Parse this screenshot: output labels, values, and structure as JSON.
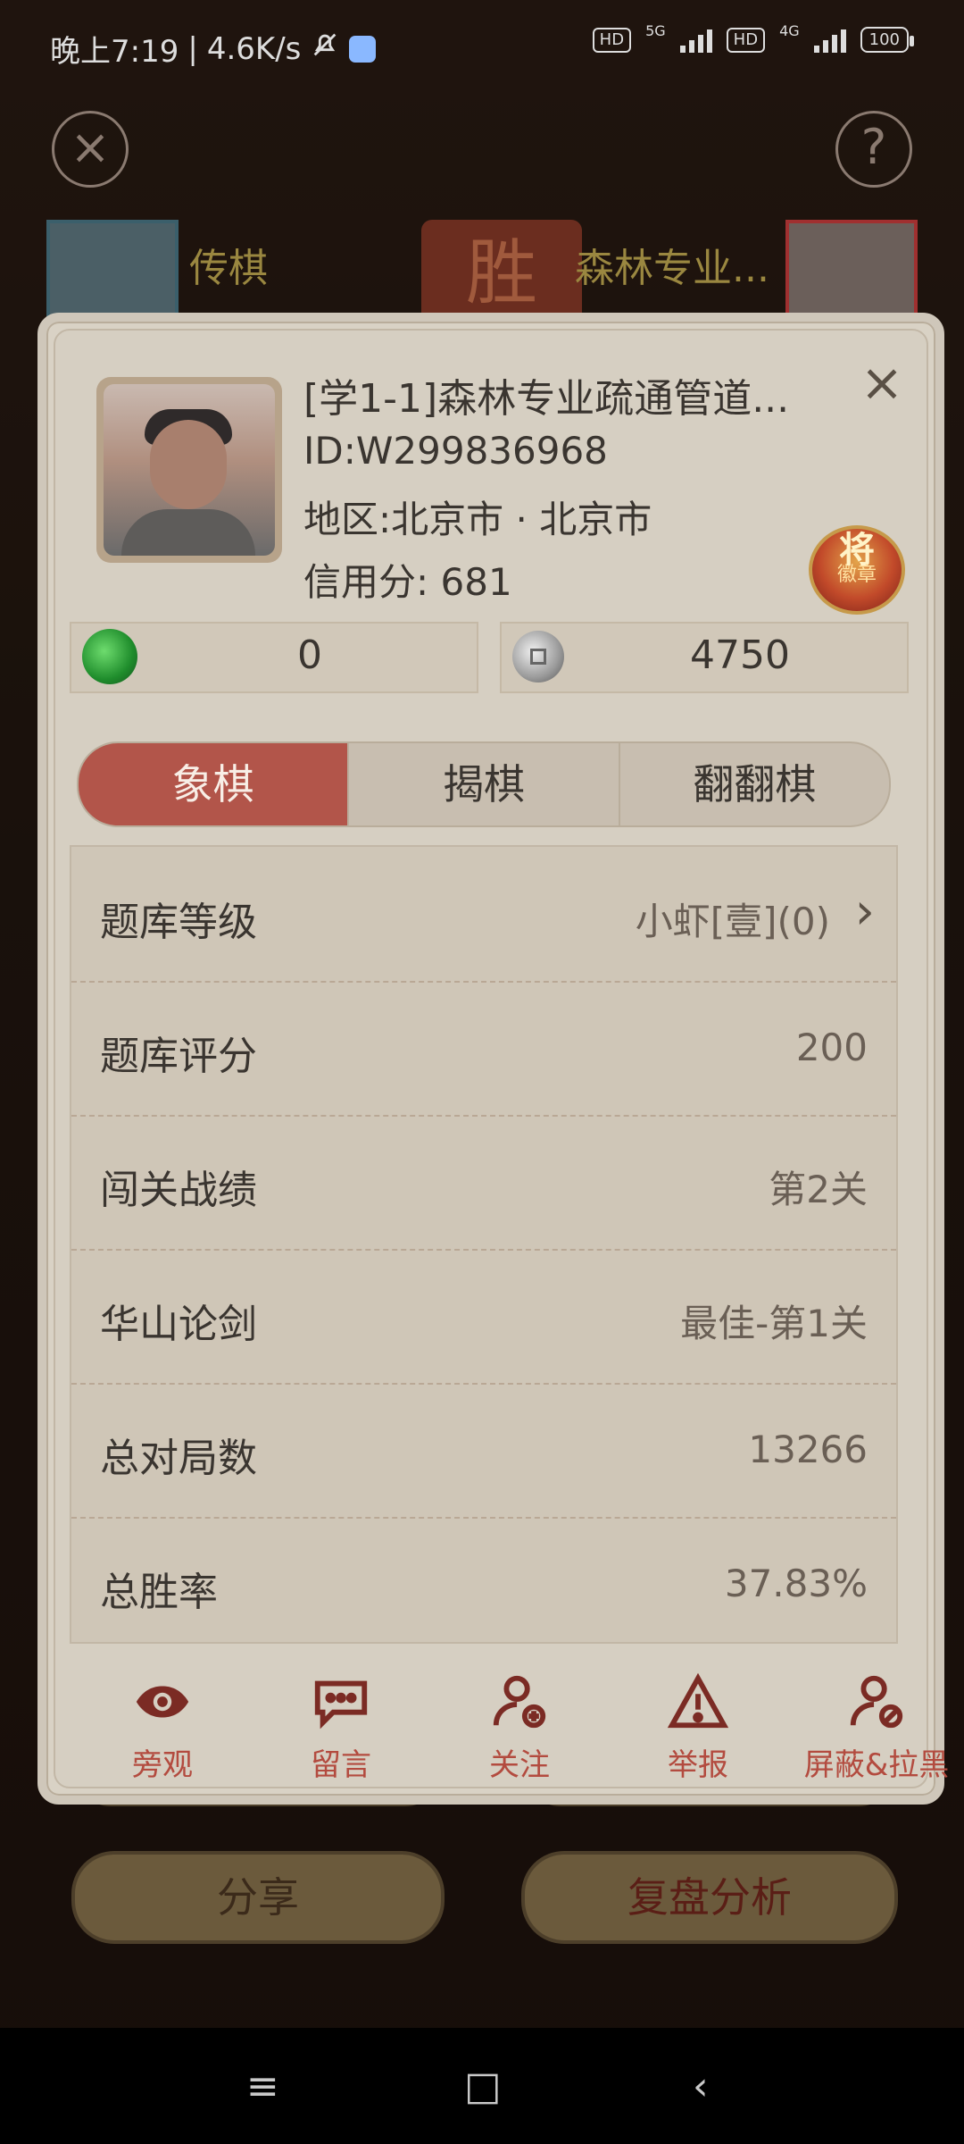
{
  "status_bar": {
    "time": "晚上7:19",
    "speed": "4.6K/s",
    "hd1": "HD",
    "net1": "5G",
    "hd2": "HD",
    "net2": "4G",
    "battery": "100"
  },
  "background": {
    "player_left_name": "传棋",
    "player_right_name": "森林专业...",
    "result_char": "胜",
    "share_label": "分享",
    "replay_label": "复盘分析"
  },
  "profile": {
    "name": "[学1-1]森林专业疏通管道...",
    "id": "ID:W299836968",
    "region": "地区:北京市 · 北京市",
    "credit": "信用分: 681",
    "badge_top": "将",
    "badge_bottom": "徽章"
  },
  "currency": {
    "green_value": "0",
    "silver_value": "4750"
  },
  "tabs": [
    "象棋",
    "揭棋",
    "翻翻棋"
  ],
  "stats": [
    {
      "label": "题库等级",
      "value": "小虾[壹](0)"
    },
    {
      "label": "题库评分",
      "value": "200"
    },
    {
      "label": "闯关战绩",
      "value": "第2关"
    },
    {
      "label": "华山论剑",
      "value": "最佳-第1关"
    },
    {
      "label": "总对局数",
      "value": "13266"
    },
    {
      "label": "总胜率",
      "value": "37.83%"
    }
  ],
  "actions": [
    {
      "label": "旁观",
      "icon": "eye-icon"
    },
    {
      "label": "留言",
      "icon": "message-icon"
    },
    {
      "label": "关注",
      "icon": "follow-icon"
    },
    {
      "label": "举报",
      "icon": "warning-icon"
    },
    {
      "label": "屏蔽&拉黑",
      "icon": "block-user-icon"
    }
  ],
  "colors": {
    "accent": "#b2554a",
    "action_text": "#b34b3f",
    "dialog_bg": "#d6cfc2"
  }
}
